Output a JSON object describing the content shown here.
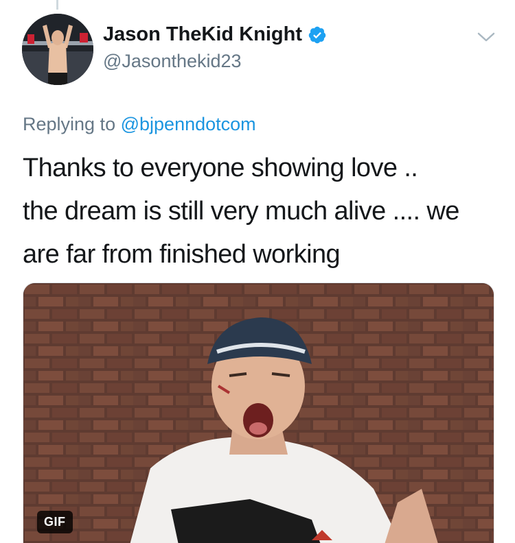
{
  "tweet": {
    "author_name": "Jason TheKid Knight",
    "handle": "@Jasonthekid23",
    "verified": true,
    "reply_prefix": "Replying to",
    "reply_to": "@bjpenndotcom",
    "text_lines": [
      "Thanks to everyone showing love ..",
      "the dream is still very much alive .... we",
      "are far from finished working"
    ],
    "media": {
      "badge": "GIF"
    }
  },
  "colors": {
    "accent": "#1b95e0",
    "muted": "#657786",
    "text": "#14171a"
  },
  "icons": {
    "verified": "verified-badge-icon",
    "menu": "chevron-down-icon"
  }
}
